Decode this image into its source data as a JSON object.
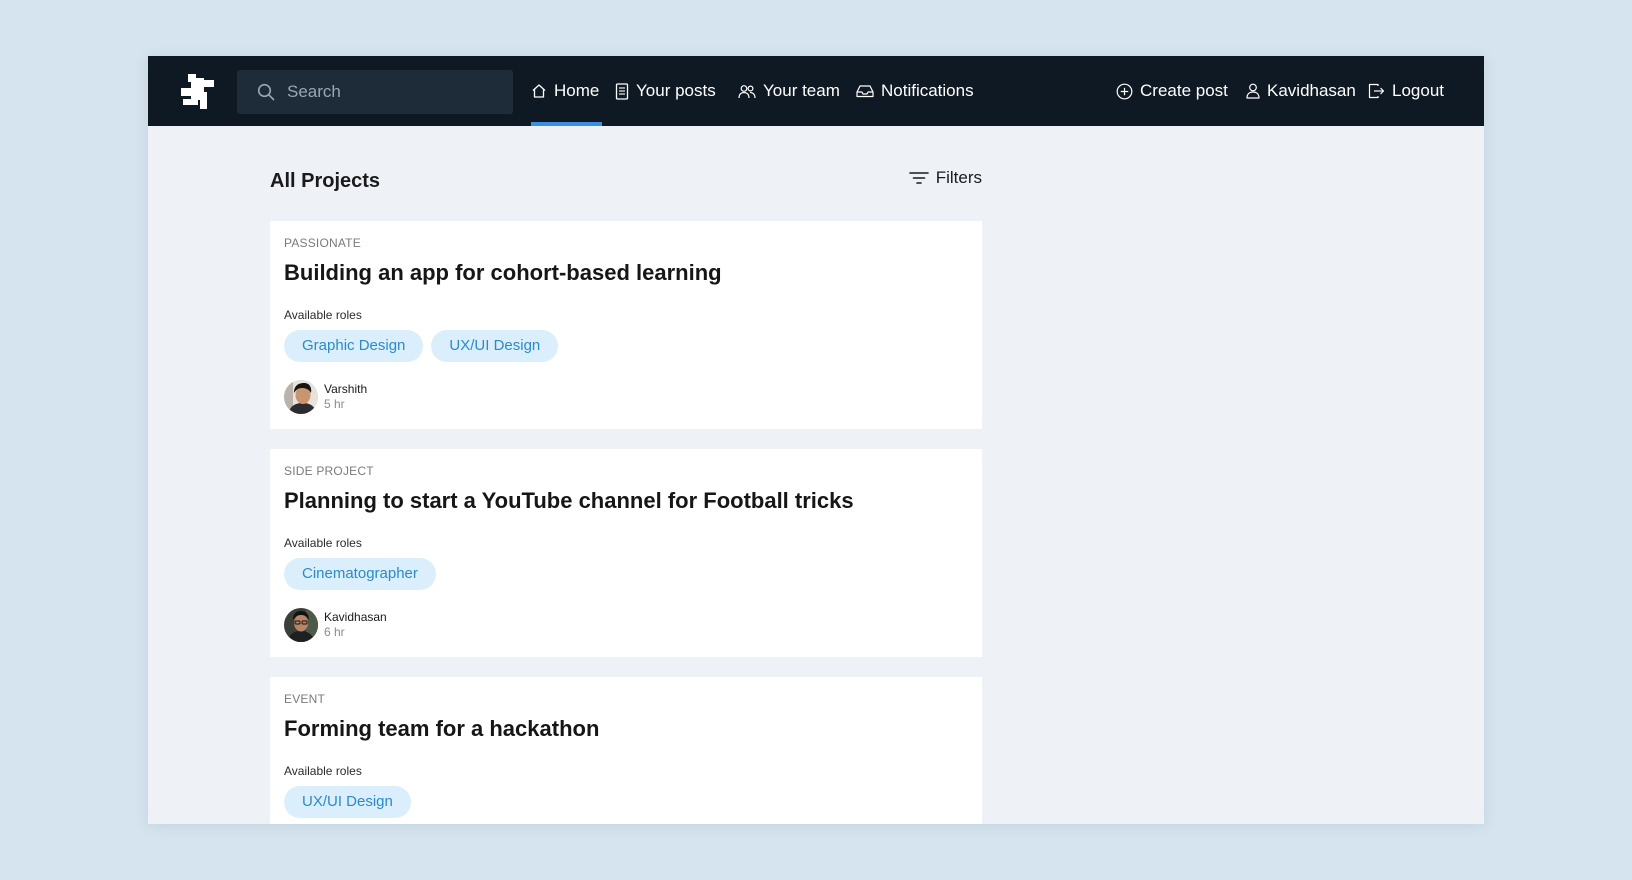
{
  "app": {
    "logo_icon": "app-logo-icon",
    "accent_color": "#3b8ee3",
    "nav_bg": "#0f1923"
  },
  "search": {
    "placeholder": "Search",
    "value": ""
  },
  "nav": {
    "home": "Home",
    "your_posts": "Your posts",
    "your_team": "Your team",
    "notifications": "Notifications",
    "active": "home"
  },
  "user_menu": {
    "create_post": "Create post",
    "username": "Kavidhasan",
    "logout": "Logout"
  },
  "main": {
    "title": "All Projects",
    "filters_label": "Filters",
    "roles_label": "Available roles",
    "projects": [
      {
        "category": "PASSIONATE",
        "title": "Building an app for cohort-based learning",
        "roles": [
          "Graphic Design",
          "UX/UI Design"
        ],
        "author": "Varshith",
        "time": "5 hr"
      },
      {
        "category": "SIDE PROJECT",
        "title": "Planning to start a YouTube channel for Football tricks",
        "roles": [
          "Cinematographer"
        ],
        "author": "Kavidhasan",
        "time": "6 hr"
      },
      {
        "category": "EVENT",
        "title": "Forming team for a hackathon",
        "roles": [
          "UX/UI Design"
        ]
      }
    ]
  },
  "colors": {
    "tag_bg": "#dbeefb",
    "tag_text": "#2a8bcc",
    "page_bg": "#eef2f6"
  }
}
